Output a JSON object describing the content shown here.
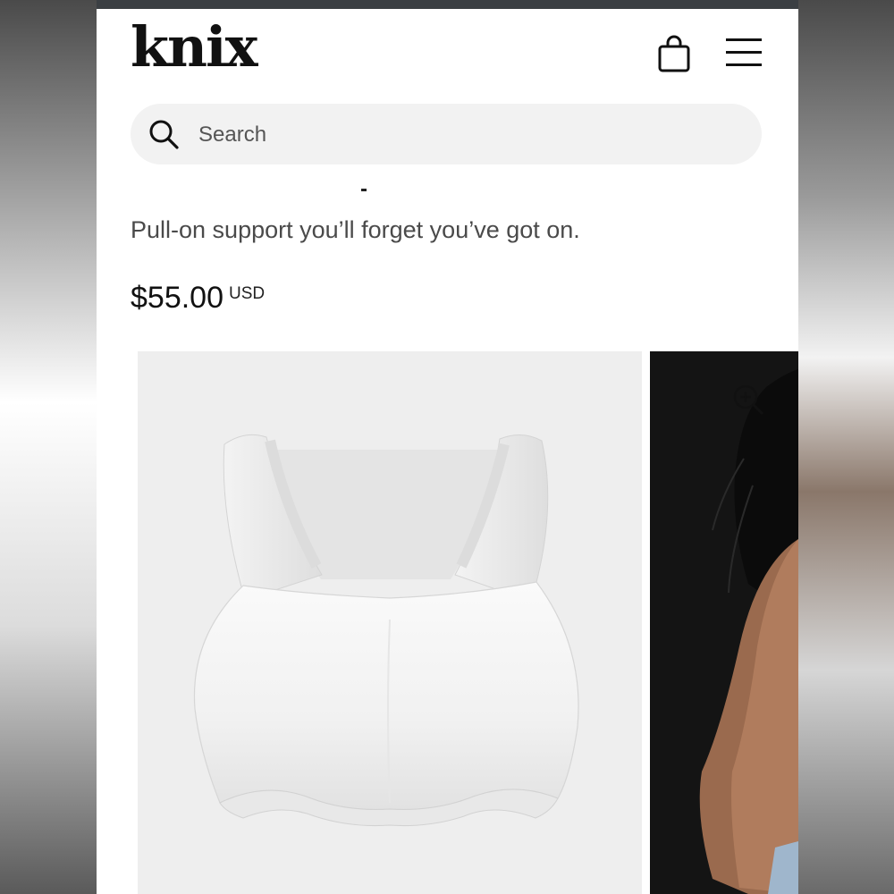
{
  "header": {
    "logo": "knix",
    "cart_icon": "shopping-bag-icon",
    "menu_icon": "hamburger-menu-icon"
  },
  "search": {
    "placeholder": "Search",
    "icon": "search-icon"
  },
  "product": {
    "tagline": "Pull-on support you’ll forget you’ve got on.",
    "price": "$55.00",
    "currency": "USD"
  },
  "gallery": {
    "main_image": "white-bra-product-photo",
    "second_image": "model-photo",
    "zoom_icon": "zoom-in-icon"
  },
  "colors": {
    "brand_text": "#111111",
    "search_bg": "#f2f2f2",
    "image_bg": "#eeeeee"
  }
}
